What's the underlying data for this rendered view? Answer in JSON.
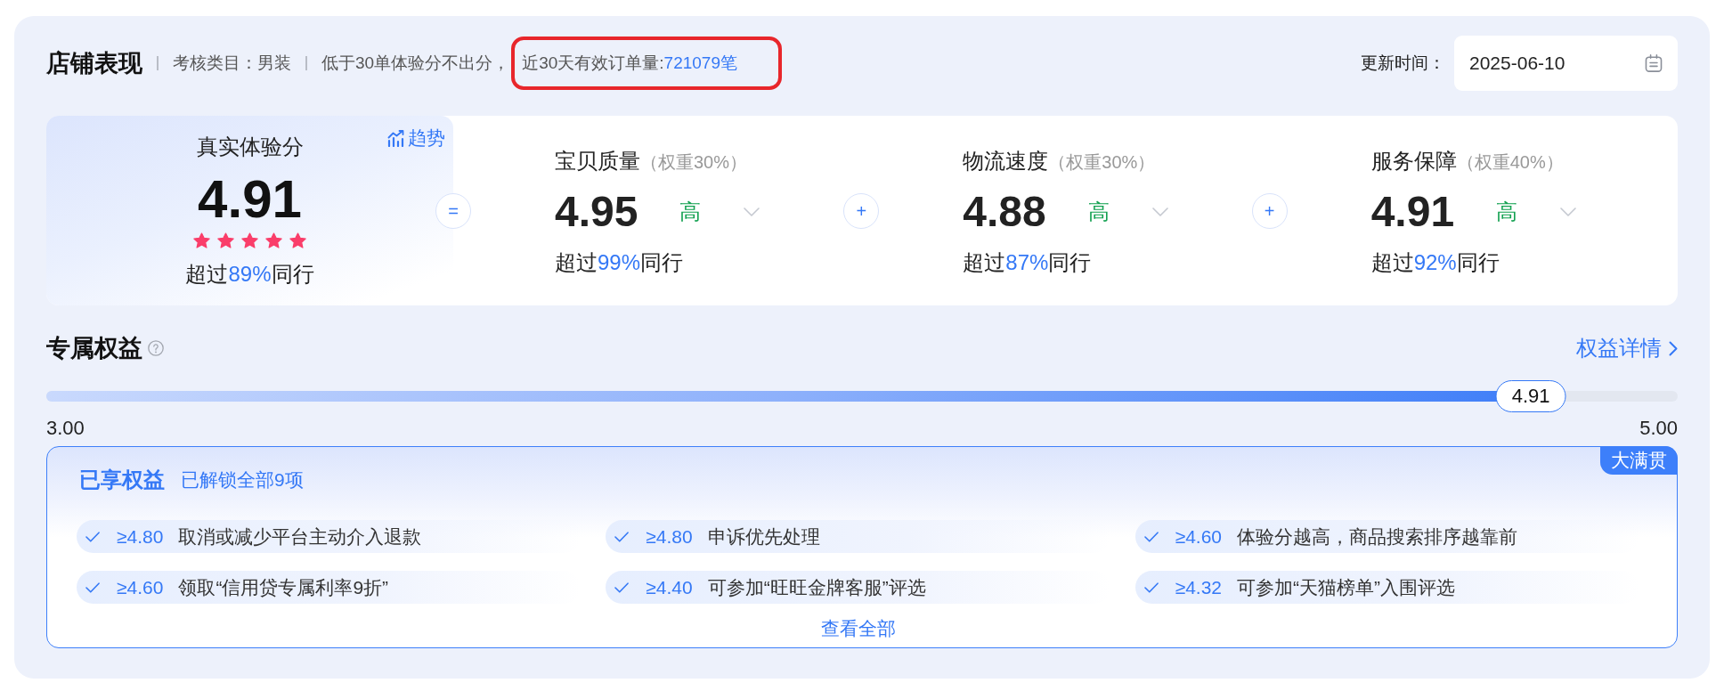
{
  "header": {
    "title": "店铺表现",
    "category": "考核类目：男装",
    "note": "低于30单体验分不出分，",
    "order_count": {
      "label": "近30天有效订单量:",
      "value": "721079笔",
      "highlighted": true
    },
    "update_label": "更新时间：",
    "update_date": "2025-06-10"
  },
  "score": {
    "overall": {
      "title": "真实体验分",
      "trend_link": "趋势",
      "value": "4.91",
      "stars": 5,
      "percentile": {
        "prefix": "超过",
        "value": "89%",
        "suffix": "同行"
      }
    },
    "metrics": [
      {
        "operator": "=",
        "name": "宝贝质量",
        "weight": "（权重30%）",
        "value": "4.95",
        "grade": "高",
        "percentile": {
          "prefix": "超过",
          "value": "99%",
          "suffix": "同行"
        }
      },
      {
        "operator": "+",
        "name": "物流速度",
        "weight": "（权重30%）",
        "value": "4.88",
        "grade": "高",
        "percentile": {
          "prefix": "超过",
          "value": "87%",
          "suffix": "同行"
        }
      },
      {
        "operator": "+",
        "name": "服务保障",
        "weight": "（权重40%）",
        "value": "4.91",
        "grade": "高",
        "percentile": {
          "prefix": "超过",
          "value": "92%",
          "suffix": "同行"
        }
      }
    ]
  },
  "benefits": {
    "title": "专属权益",
    "detail_link": "权益详情",
    "progress": {
      "min": "3.00",
      "max": "5.00",
      "value": "4.91",
      "level": 0.91
    },
    "panel": {
      "title": "已享权益",
      "summary": "已解锁全部9项",
      "badge": "大满贯",
      "items": [
        {
          "threshold": "≥4.80",
          "text": "取消或减少平台主动介入退款"
        },
        {
          "threshold": "≥4.80",
          "text": "申诉优先处理"
        },
        {
          "threshold": "≥4.60",
          "text": "体验分越高，商品搜索排序越靠前"
        },
        {
          "threshold": "≥4.60",
          "text": "领取“信用贷专属利率9折”"
        },
        {
          "threshold": "≥4.40",
          "text": "可参加“旺旺金牌客服”评选"
        },
        {
          "threshold": "≥4.32",
          "text": "可参加“天猫榜单”入围评选"
        }
      ],
      "more_link": "查看全部"
    }
  }
}
